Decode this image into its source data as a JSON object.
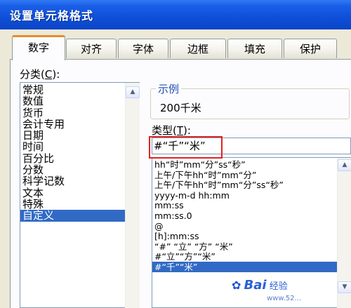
{
  "window": {
    "title": "设置单元格格式"
  },
  "tabs": [
    {
      "label": "数字"
    },
    {
      "label": "对齐"
    },
    {
      "label": "字体"
    },
    {
      "label": "边框"
    },
    {
      "label": "填充"
    },
    {
      "label": "保护"
    }
  ],
  "category": {
    "label": "分类",
    "accel": "C",
    "items": [
      "常规",
      "数值",
      "货币",
      "会计专用",
      "日期",
      "时间",
      "百分比",
      "分数",
      "科学记数",
      "文本",
      "特殊",
      "自定义"
    ],
    "selected": "自定义"
  },
  "sample": {
    "label": "示例",
    "value": "200千米"
  },
  "type_field": {
    "label": "类型",
    "accel": "T",
    "value": "#“千”“米”"
  },
  "formats": {
    "items": [
      "hh“时”mm“分”ss“秒”",
      "上午/下午hh“时”mm“分”",
      "上午/下午hh“时”mm“分”ss“秒”",
      "yyyy-m-d hh:mm",
      "mm:ss",
      "mm:ss.0",
      "@",
      "[h]:mm:ss",
      "“#” “立” “方” “米”",
      "#“立”“方”“米”",
      "#“千”“米”"
    ],
    "selected": "#“千”“米”"
  },
  "watermark": {
    "brand": "Bai",
    "suffix": "经验",
    "url": "www.52..."
  },
  "colors": {
    "titlebar": "#0f4fd8",
    "selection": "#316ac5",
    "active_tab_accent": "#e68b2c",
    "highlight": "#e52020"
  }
}
